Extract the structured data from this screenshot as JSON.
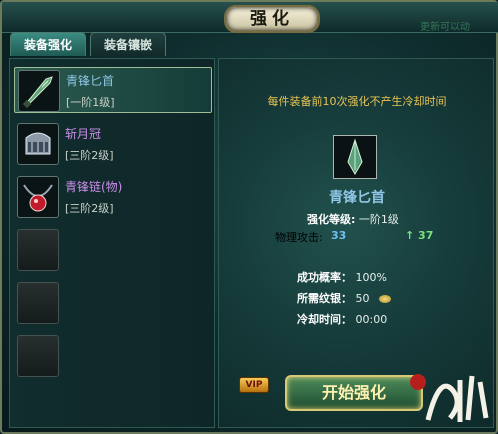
{
  "window": {
    "title": "强化",
    "background_text": "更新可以动"
  },
  "tabs": [
    {
      "label": "装备强化",
      "active": true
    },
    {
      "label": "装备镶嵌",
      "active": false
    }
  ],
  "equipment_list": [
    {
      "name": "青锋匕首",
      "level": "[一阶1级]",
      "color": "#8fc6e6",
      "icon": "dagger-icon",
      "selected": true
    },
    {
      "name": "斩月冠",
      "level": "[三阶2级]",
      "color": "#c98de8",
      "icon": "helmet-icon",
      "selected": false
    },
    {
      "name": "青锋链(物)",
      "level": "[三阶2级]",
      "color": "#c98de8",
      "icon": "necklace-icon",
      "selected": false
    }
  ],
  "empty_slots": 3,
  "detail": {
    "notice": "每件装备前10次强化不产生冷却时间",
    "item_name": "青锋匕首",
    "item_icon": "dagger-icon",
    "enhance_level_label": "强化等级:",
    "enhance_level_value": "一阶1级",
    "attack_label": "物理攻击:",
    "attack_value": "33",
    "attack_increase": "↑ 37",
    "success_rate_label": "成功概率：",
    "success_rate_value": "100%",
    "silver_label": "所需纹银：",
    "silver_value": "50",
    "cooldown_label": "冷却时间：",
    "cooldown_value": "00:00"
  },
  "buttons": {
    "start": "开始强化",
    "vip": "VIP"
  },
  "logo": {
    "text": "仙剑"
  },
  "colors": {
    "accent_gold": "#e8c454",
    "attack_blue": "#6fc0ef",
    "increase_green": "#7be27a"
  }
}
